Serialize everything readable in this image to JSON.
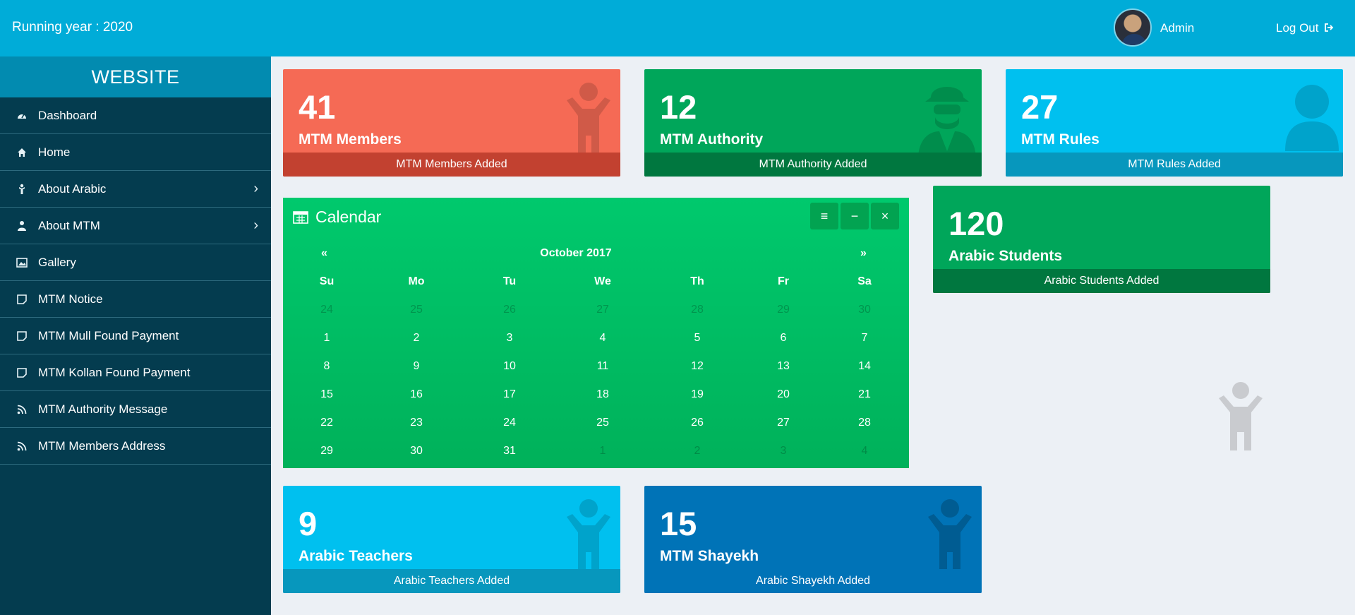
{
  "topbar": {
    "running_year": "Running year : 2020",
    "admin_label": "Admin",
    "logout_label": "Log Out"
  },
  "sidebar": {
    "brand": "WEBSITE",
    "items": [
      {
        "label": "Dashboard",
        "icon": "dashboard-icon",
        "has_submenu": false
      },
      {
        "label": "Home",
        "icon": "home-icon",
        "has_submenu": false
      },
      {
        "label": "About Arabic",
        "icon": "person-icon",
        "has_submenu": true
      },
      {
        "label": "About MTM",
        "icon": "user-icon",
        "has_submenu": true
      },
      {
        "label": "Gallery",
        "icon": "image-icon",
        "has_submenu": false
      },
      {
        "label": "MTM Notice",
        "icon": "note-icon",
        "has_submenu": false
      },
      {
        "label": "MTM Mull Found Payment",
        "icon": "note-icon",
        "has_submenu": false
      },
      {
        "label": "MTM Kollan Found Payment",
        "icon": "note-icon",
        "has_submenu": false
      },
      {
        "label": "MTM Authority Message",
        "icon": "rss-icon",
        "has_submenu": false
      },
      {
        "label": "MTM Members Address",
        "icon": "rss-icon",
        "has_submenu": false
      }
    ]
  },
  "cards": {
    "members": {
      "number": "41",
      "label": "MTM Members",
      "footer": "MTM Members Added",
      "color": "#f56a55",
      "footer_color": "#c24130"
    },
    "authority": {
      "number": "12",
      "label": "MTM Authority",
      "footer": "MTM Authority Added",
      "color": "#00a65a",
      "footer_color": "#00773f"
    },
    "rules": {
      "number": "27",
      "label": "MTM Rules",
      "footer": "MTM Rules Added",
      "color": "#00c0ef",
      "footer_color": "#0797bd"
    },
    "students": {
      "number": "120",
      "label": "Arabic Students",
      "footer": "Arabic Students Added",
      "color": "#00a65a",
      "footer_color": "#00773f"
    },
    "teachers": {
      "number": "9",
      "label": "Arabic Teachers",
      "footer": "Arabic Teachers Added",
      "color": "#00c0ef",
      "footer_color": "#0797bd"
    },
    "shayekh": {
      "number": "15",
      "label": "MTM Shayekh",
      "footer": "Arabic Shayekh Added",
      "color": "#0073b7",
      "footer_color": "#0073b7"
    }
  },
  "calendar": {
    "title": "Calendar",
    "month": "October 2017",
    "prev": "«",
    "next": "»",
    "menu_icon": "≡",
    "minimize_icon": "−",
    "close_icon": "×",
    "days_of_week": [
      "Su",
      "Mo",
      "Tu",
      "We",
      "Th",
      "Fr",
      "Sa"
    ],
    "weeks": [
      [
        "24",
        "25",
        "26",
        "27",
        "28",
        "29",
        "30"
      ],
      [
        "1",
        "2",
        "3",
        "4",
        "5",
        "6",
        "7"
      ],
      [
        "8",
        "9",
        "10",
        "11",
        "12",
        "13",
        "14"
      ],
      [
        "15",
        "16",
        "17",
        "18",
        "19",
        "20",
        "21"
      ],
      [
        "22",
        "23",
        "24",
        "25",
        "26",
        "27",
        "28"
      ],
      [
        "29",
        "30",
        "31",
        "1",
        "2",
        "3",
        "4"
      ]
    ],
    "muted_weeks": {
      "0": [
        0,
        1,
        2,
        3,
        4,
        5,
        6
      ],
      "5": [
        3,
        4,
        5,
        6
      ]
    }
  }
}
